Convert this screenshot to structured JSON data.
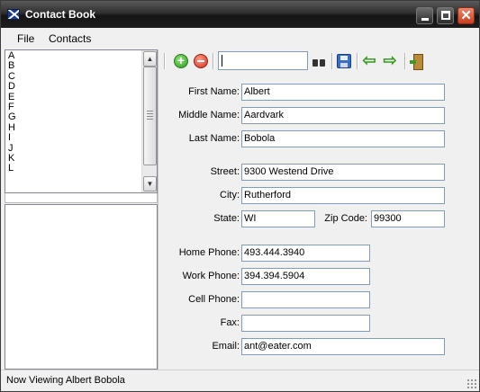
{
  "window": {
    "title": "Contact Book"
  },
  "menu": {
    "file": "File",
    "contacts": "Contacts"
  },
  "index_letters": [
    "A",
    "B",
    "C",
    "D",
    "E",
    "F",
    "G",
    "H",
    "I",
    "J",
    "K",
    "L"
  ],
  "toolbar": {
    "search_value": ""
  },
  "form": {
    "first_name_label": "First Name:",
    "first_name": "Albert",
    "middle_name_label": "Middle Name:",
    "middle_name": "Aardvark",
    "last_name_label": "Last Name:",
    "last_name": "Bobola",
    "street_label": "Street:",
    "street": "9300 Westend Drive",
    "city_label": "City:",
    "city": "Rutherford",
    "state_label": "State:",
    "state": "WI",
    "zip_label": "Zip Code:",
    "zip": "99300",
    "home_phone_label": "Home Phone:",
    "home_phone": "493.444.3940",
    "work_phone_label": "Work Phone:",
    "work_phone": "394.394.5904",
    "cell_phone_label": "Cell Phone:",
    "cell_phone": "",
    "fax_label": "Fax:",
    "fax": "",
    "email_label": "Email:",
    "email": "ant@eater.com"
  },
  "status": {
    "text": "Now Viewing Albert Bobola"
  }
}
